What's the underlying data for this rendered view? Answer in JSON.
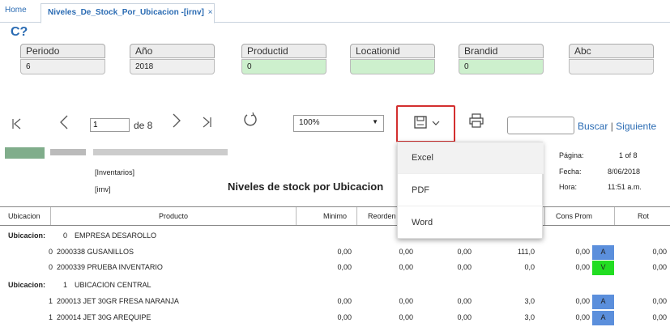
{
  "tabs": {
    "home": "Home",
    "active": "Niveles_De_Stock_Por_Ubicacion -[irnv]",
    "close": "×"
  },
  "params": [
    {
      "label": "Periodo",
      "value": "6",
      "green": false
    },
    {
      "label": "Año",
      "value": "2018",
      "green": false
    },
    {
      "label": "Productid",
      "value": "0",
      "green": true
    },
    {
      "label": "Locationid",
      "value": "",
      "green": true
    },
    {
      "label": "Brandid",
      "value": "0",
      "green": true
    },
    {
      "label": "Abc",
      "value": "",
      "green": false
    }
  ],
  "toolbar": {
    "page": "1",
    "of_pages": "de 8",
    "zoom": "100%",
    "search_label": "Buscar",
    "next_label": "Siguiente",
    "separator": "|"
  },
  "export_menu": {
    "items": [
      "Excel",
      "PDF",
      "Word"
    ]
  },
  "report": {
    "title": "Niveles de stock por Ubicacion",
    "subtitle1": "[Inventarios]",
    "subtitle2": "[irnv]",
    "pagina_label": "Página:",
    "pagina_value": "1 of 8",
    "fecha_label": "Fecha:",
    "fecha_value": "8/06/2018",
    "hora_label": "Hora:",
    "hora_value": "11:51 a.m."
  },
  "table": {
    "headers": {
      "ubicacion": "Ubicacion",
      "producto": "Producto",
      "minimo": "Minimo",
      "reorden": "Reorden",
      "cons_prom": "Cons Prom",
      "rot": "Rot"
    },
    "rows": [
      {
        "type": "group",
        "label": "Ubicacion:",
        "num": "0",
        "name": "EMPRESA DESAROLLO"
      },
      {
        "type": "item",
        "num": "0",
        "producto": "2000338 GUSANILLOS",
        "minimo": "0,00",
        "reorden": "0,00",
        "c3": "0,00",
        "c4": "111,0",
        "cons": "0,00",
        "abc": "A",
        "abc_color": "#5b8fdc",
        "rot": "0,00"
      },
      {
        "type": "item",
        "num": "0",
        "producto": "2000339 PRUEBA INVENTARIO",
        "minimo": "0,00",
        "reorden": "0,00",
        "c3": "0,00",
        "c4": "0,0",
        "cons": "0,00",
        "abc": "V",
        "abc_color": "#22dd22",
        "rot": "0,00"
      },
      {
        "type": "group",
        "label": "Ubicacion:",
        "num": "1",
        "name": "UBICACION CENTRAL"
      },
      {
        "type": "item",
        "num": "1",
        "producto": "200013 JET 30GR FRESA NARANJA",
        "minimo": "0,00",
        "reorden": "0,00",
        "c3": "0,00",
        "c4": "3,0",
        "cons": "0,00",
        "abc": "A",
        "abc_color": "#5b8fdc",
        "rot": "0,00"
      },
      {
        "type": "item",
        "num": "1",
        "producto": "200014 JET 30G AREQUIPE",
        "minimo": "0,00",
        "reorden": "0,00",
        "c3": "0,00",
        "c4": "3,0",
        "cons": "0,00",
        "abc": "A",
        "abc_color": "#5b8fdc",
        "rot": "0,00"
      }
    ]
  },
  "icons": [
    "first-page-icon",
    "prev-page-icon",
    "next-page-icon",
    "last-page-icon",
    "refresh-icon",
    "save-icon",
    "chevron-down-icon",
    "print-icon",
    "help-refresh-icon"
  ]
}
